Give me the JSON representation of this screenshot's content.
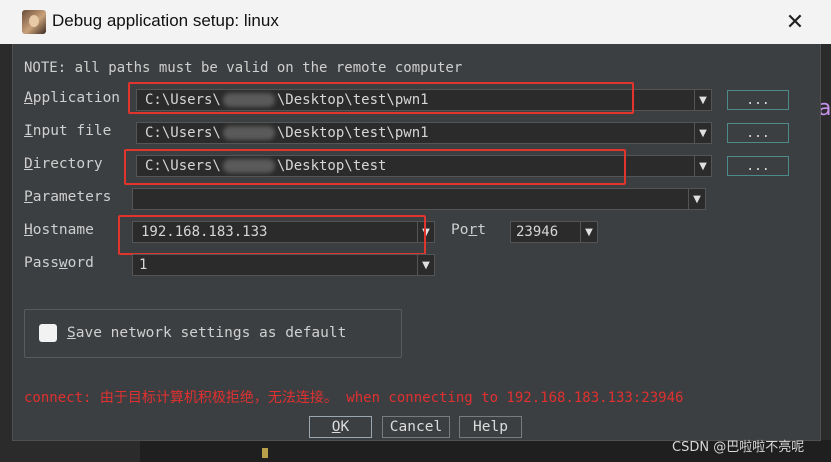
{
  "window": {
    "title": "Debug application setup: linux"
  },
  "note": "NOTE: all paths must be valid on the remote computer",
  "fields": {
    "application": {
      "label_hot": "A",
      "label_rest": "pplication",
      "value_prefix": "C:\\Users\\",
      "value_suffix": "\\Desktop\\test\\pwn1",
      "browse": "..."
    },
    "input_file": {
      "label_hot": "I",
      "label_rest": "nput file",
      "value_prefix": "C:\\Users\\",
      "value_suffix": "\\Desktop\\test\\pwn1",
      "browse": "..."
    },
    "directory": {
      "label_hot": "D",
      "label_rest": "irectory",
      "value_prefix": "C:\\Users\\",
      "value_suffix": "\\Desktop\\test",
      "browse": "..."
    },
    "parameters": {
      "label_hot": "P",
      "label_rest": "arameters",
      "value": ""
    },
    "hostname": {
      "label_hot": "H",
      "label_rest": "ostname",
      "value": "192.168.183.133"
    },
    "port": {
      "label_pre": "Po",
      "label_hot": "r",
      "label_rest": "t",
      "value": "23946"
    },
    "password": {
      "label_pre": "Pass",
      "label_hot": "w",
      "label_rest": "ord",
      "value": "1"
    }
  },
  "save_settings": {
    "label_hot": "S",
    "label_rest": "ave network settings as default",
    "checked": false
  },
  "error_message": "connect: 由于目标计算机积极拒绝，无法连接。 when connecting to 192.168.183.133:23946",
  "buttons": {
    "ok": {
      "hot": "O",
      "rest": "K"
    },
    "cancel": "Cancel",
    "help": "Help"
  },
  "watermark": "CSDN @巴啦啦不亮呢",
  "colors": {
    "highlight": "#e0342c",
    "error": "#e03030",
    "dialog_bg": "#3c3f41",
    "field_bg": "#2b2b2b"
  }
}
